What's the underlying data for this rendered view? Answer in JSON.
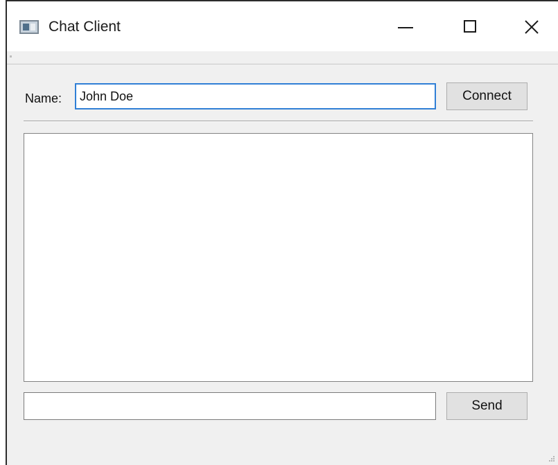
{
  "window": {
    "title": "Chat Client",
    "icon": "app-window-icon",
    "controls": {
      "minimize_icon": "minimize-icon",
      "maximize_icon": "maximize-icon",
      "close_icon": "close-icon"
    }
  },
  "connection": {
    "name_label": "Name:",
    "name_value": "John Doe",
    "connect_label": "Connect"
  },
  "chat": {
    "messages": []
  },
  "compose": {
    "message_value": "",
    "send_label": "Send"
  },
  "colors": {
    "focus_border": "#2f7fd6",
    "button_face": "#e1e1e1",
    "window_bg": "#f0f0f0"
  }
}
